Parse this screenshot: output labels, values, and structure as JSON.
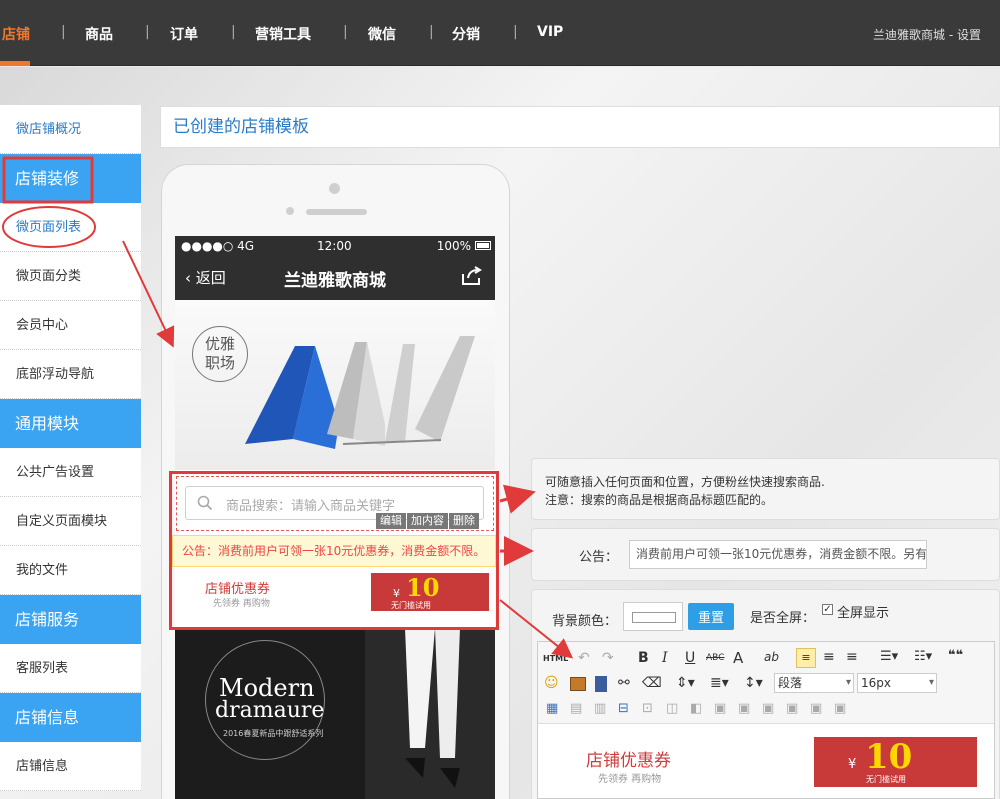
{
  "topnav": {
    "items": [
      "店铺",
      "商品",
      "订单",
      "营销工具",
      "微信",
      "分销",
      "VIP"
    ],
    "separator": "|",
    "right": "兰迪雅歌商城 - 设置",
    "accent": "#f0772b"
  },
  "sidebar": {
    "overview": "微店铺概况",
    "group1": "店铺装修",
    "g1_items": [
      "微页面列表",
      "微页面分类",
      "会员中心",
      "底部浮动导航"
    ],
    "group2": "通用模块",
    "g2_items": [
      "公共广告设置",
      "自定义页面模块",
      "我的文件"
    ],
    "group3": "店铺服务",
    "g3_items": [
      "客服列表"
    ],
    "group4": "店铺信息",
    "g4_items": [
      "店铺信息"
    ]
  },
  "section_title": "已创建的店铺模板",
  "phone": {
    "status_signal": "●●●●○ 4G",
    "status_time": "12:00",
    "status_battery": "100%",
    "back": "返回",
    "title": "兰迪雅歌商城",
    "hero_badge_line1": "优雅",
    "hero_badge_line2": "职场",
    "search_placeholder": "商品搜索：请输入商品关键字",
    "edit_actions": [
      "编辑",
      "加内容",
      "删除"
    ],
    "notice": "公告：消费前用户可领一张10元优惠券，消费金额不限。",
    "coupon_title": "店铺优惠券",
    "coupon_sub": "先领券  再购物",
    "coupon_yen": "¥",
    "coupon_amount": "10",
    "coupon_note": "无门槛试用",
    "hero2_brand1": "Modern",
    "hero2_brand2": "dramaure",
    "hero2_small": "2016春夏新品中跟舒适系列"
  },
  "panels": {
    "search_tip_1": "可随意插入任何页面和位置，方便粉丝快速搜索商品.",
    "search_tip_2": "注意：搜索的商品是根据商品标题匹配的。",
    "notice_label": "公告：",
    "notice_value": "消费前用户可领一张10元优惠券，消费金额不限。另有",
    "bg_color_label": "背景颜色：",
    "reset_button": "重置",
    "fullscreen_label": "是否全屏：",
    "fullscreen_check": "✓",
    "fullscreen_text": "全屏显示"
  },
  "editor": {
    "html_label": "HTML",
    "bold": "B",
    "italic": "I",
    "underline": "U",
    "strike": "ABC",
    "font_color": "A",
    "highlight": "ab",
    "quote": "❝❝",
    "paragraph_select": "段落",
    "fontsize_select": "16px",
    "coupon_title": "店铺优惠券",
    "coupon_sub": "先领券  再购物",
    "coupon_yen": "¥",
    "coupon_amount": "10",
    "coupon_note": "无门槛试用"
  }
}
